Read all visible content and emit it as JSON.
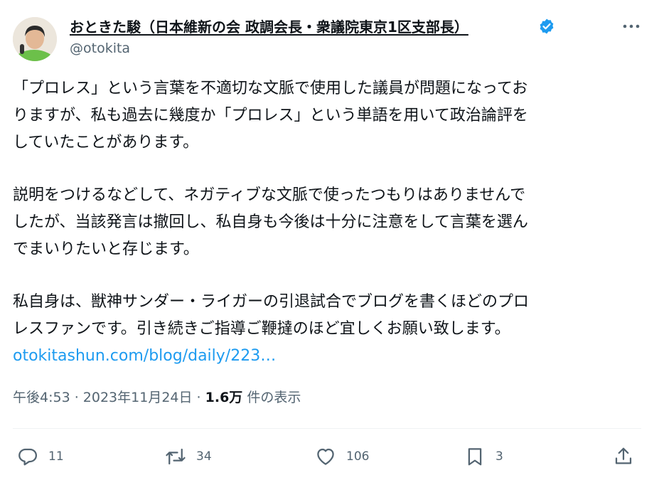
{
  "author": {
    "display_name": "おときた駿（日本維新の会 政調会長・衆議院東京1区支部長）",
    "handle": "@otokita",
    "verified": true
  },
  "tweet": {
    "paragraphs": [
      "「プロレス」という言葉を不適切な文脈で使用した議員が問題になってお\nりますが、私も過去に幾度か「プロレス」という単語を用いて政治論評を\nしていたことがあります。",
      "説明をつけるなどして、ネガティブな文脈で使ったつもりはありませんで\nしたが、当該発言は撤回し、私自身も今後は十分に注意をして言葉を選ん\nでまいりたいと存じます。",
      "私自身は、獣神サンダー・ライガーの引退試合でブログを書くほどのプロ\nレスファンです。引き続きご指導ご鞭撻のほど宜しくお願い致します。"
    ],
    "link": "otokitashun.com/blog/daily/223…"
  },
  "meta": {
    "timestamp": "午後4:53 · 2023年11月24日 · ",
    "views": "1.6万",
    "views_suffix": " 件の表示"
  },
  "actions": {
    "replies": "11",
    "reposts": "34",
    "likes": "106",
    "bookmarks": "3"
  },
  "colors": {
    "text": "#0f1419",
    "secondary": "#536471",
    "link": "#1d9bf0",
    "verified": "#1d9bf0"
  },
  "icons": [
    "more-icon",
    "verified-icon",
    "reply-icon",
    "repost-icon",
    "like-icon",
    "bookmark-icon",
    "share-icon"
  ]
}
